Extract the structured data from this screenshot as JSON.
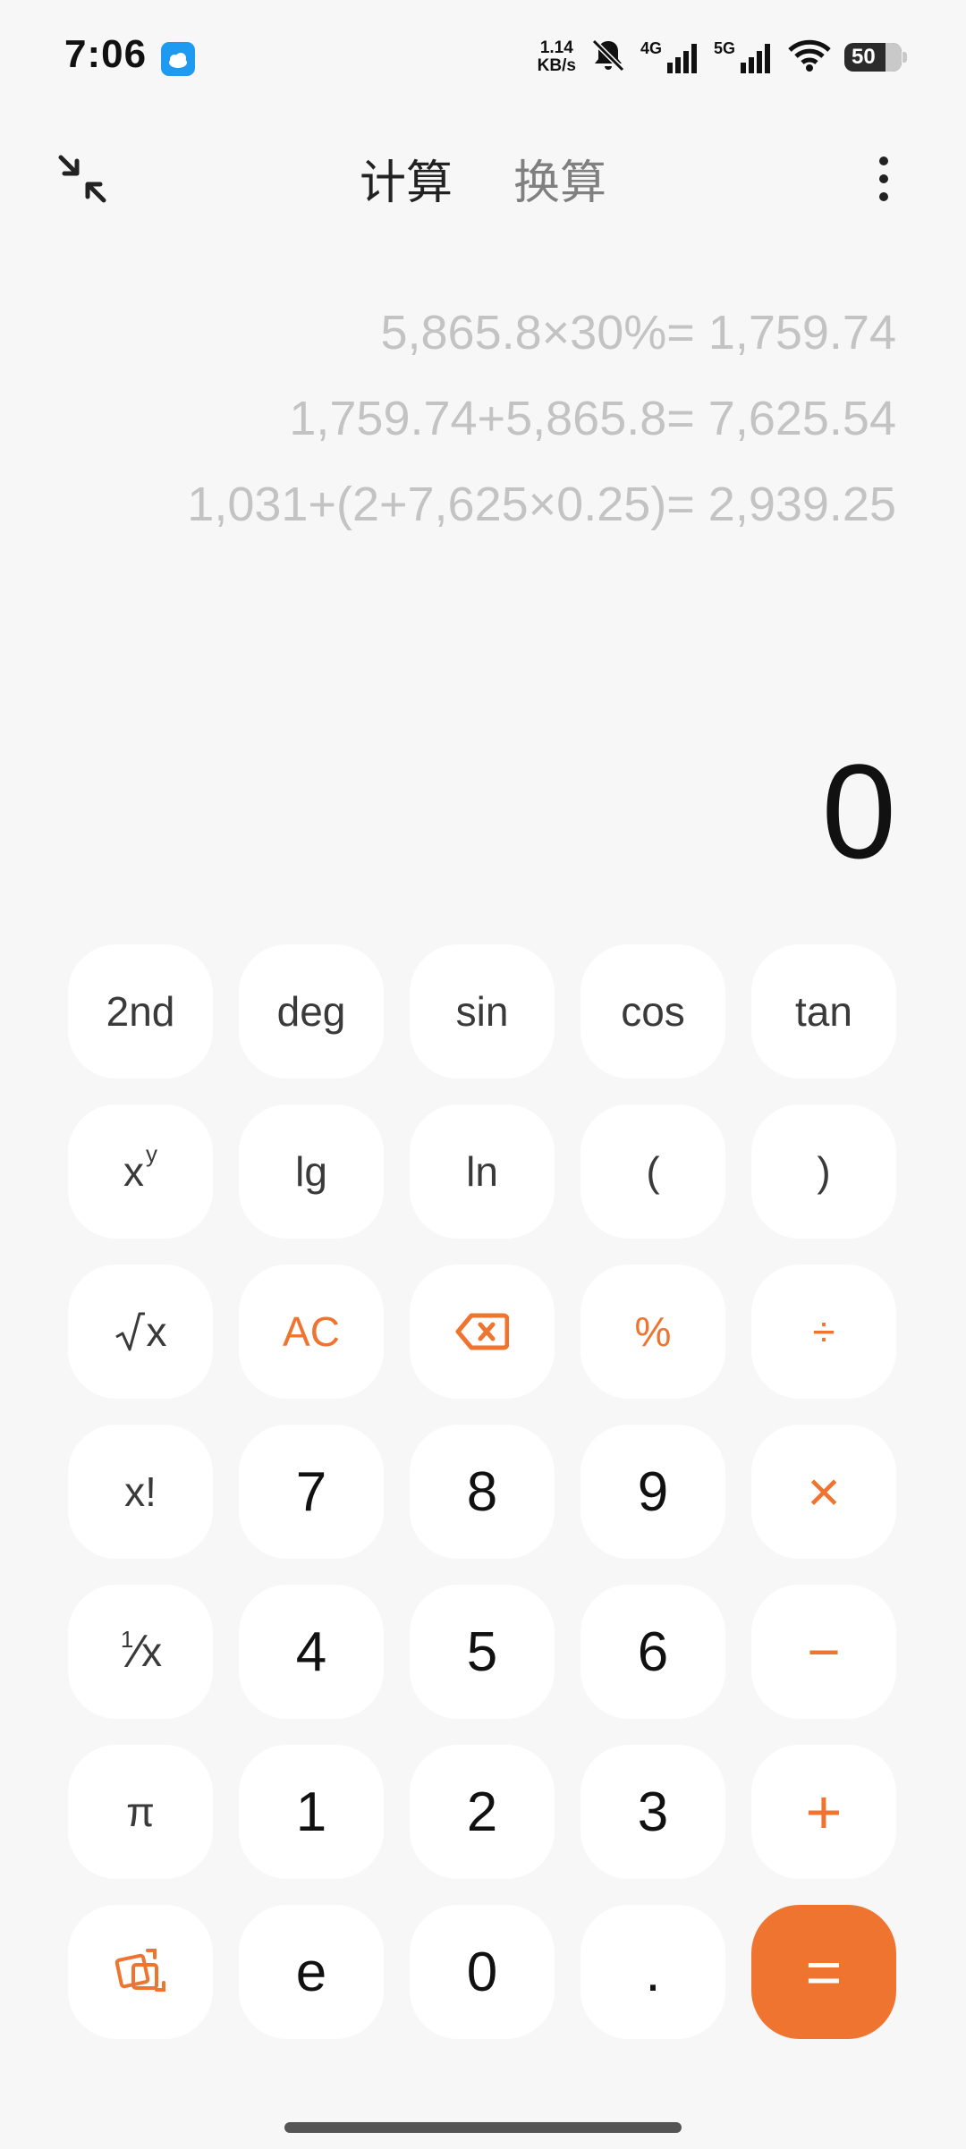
{
  "status_bar": {
    "time": "7:06",
    "net_speed_value": "1.14",
    "net_speed_unit": "KB/s",
    "signal1_label": "4G",
    "signal2_label": "5G",
    "battery": "50",
    "icons": [
      "weather-icon",
      "mute-icon",
      "signal-icon",
      "wifi-icon",
      "battery-icon"
    ]
  },
  "header": {
    "tabs": [
      {
        "label": "计算",
        "active": true
      },
      {
        "label": "换算",
        "active": false
      }
    ]
  },
  "history": [
    "5,865.8×30%= 1,759.74",
    "1,759.74+5,865.8= 7,625.54",
    "1,031+(2+7,625×0.25)= 2,939.25"
  ],
  "display": {
    "result": "0"
  },
  "keypad": {
    "k2nd": "2nd",
    "deg": "deg",
    "sin": "sin",
    "cos": "cos",
    "tan": "tan",
    "xy_base": "x",
    "xy_exp": "y",
    "lg": "lg",
    "ln": "ln",
    "lparen": "(",
    "rparen": ")",
    "sqrt_x": "x",
    "ac": "AC",
    "percent": "%",
    "divide": "÷",
    "fact": "x!",
    "k7": "7",
    "k8": "8",
    "k9": "9",
    "multiply": "×",
    "recip_1": "1",
    "recip_x": "x",
    "k4": "4",
    "k5": "5",
    "k6": "6",
    "minus": "−",
    "pi": "π",
    "k1": "1",
    "k2": "2",
    "k3": "3",
    "plus": "+",
    "e": "e",
    "k0": "0",
    "dot": ".",
    "equals": "="
  },
  "colors": {
    "accent": "#ef7430",
    "background": "#f7f7f7",
    "key": "#ffffff"
  }
}
